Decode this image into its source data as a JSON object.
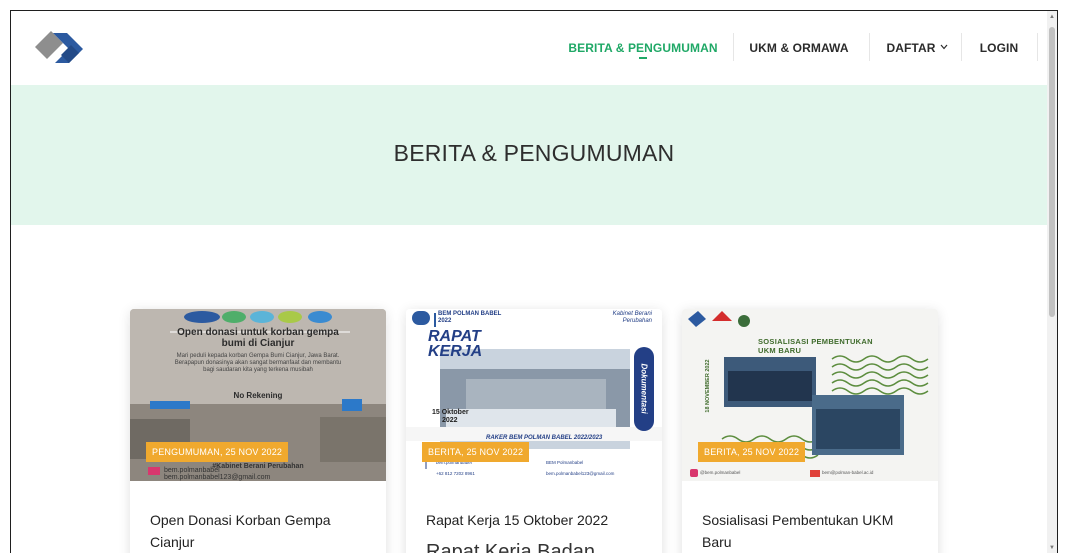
{
  "nav": {
    "items": [
      {
        "label": "BERITA & PENGUMUMAN",
        "active": true
      },
      {
        "label": "UKM & ORMAWA",
        "active": false
      },
      {
        "label": "DAFTAR",
        "active": false,
        "dropdown": true
      },
      {
        "label": "LOGIN",
        "active": false
      }
    ]
  },
  "hero": {
    "title": "BERITA & PENGUMUMAN"
  },
  "cards": [
    {
      "badge": "PENGUMUMAN, 25 NOV 2022",
      "title": "Open Donasi Korban Gempa Cianjur",
      "subtitle": "",
      "poster": {
        "headline": "Open donasi untuk korban gempa bumi di Cianjur",
        "rekening": "No Rekening",
        "footer_brand": "#Kabinet Berani Perubahan",
        "instagram": "bem.polmanbabel",
        "email": "bem.polmanbabel123@gmail.com"
      }
    },
    {
      "badge": "BERITA, 25 NOV 2022",
      "title": "Rapat Kerja 15 Oktober 2022",
      "subtitle": "Rapat Kerja Badan",
      "poster": {
        "org": "BEM POLMAN BABEL",
        "year": "2022",
        "cabinet": "Kabinet Berani Perubahan",
        "headline_1": "RAPAT",
        "headline_2": "KERJA",
        "date_1": "15 Oktober",
        "date_2": "2022",
        "side_label": "Dokumentasi",
        "bottom_title": "RAKER BEM POLMAN BABEL 2022/2023",
        "contact_web": "bem.polmanbabel",
        "contact_phone": "+62 812 7202 8961",
        "contact_yt": "BEM Polmanbabel",
        "contact_email": "bem.polmanbabel123@gmail.com"
      }
    },
    {
      "badge": "BERITA, 25 NOV 2022",
      "title": "Sosialisasi Pembentukan UKM Baru",
      "subtitle": "",
      "poster": {
        "headline_1": "SOSIALISASI PEMBENTUKAN",
        "headline_2": "UKM BARU",
        "date_vertical": "18 NOVEMBER 2022",
        "instagram": "@bem.polmanbabel",
        "email": "bem@polman-babel.ac.id"
      }
    }
  ],
  "colors": {
    "accent": "#1fa866",
    "hero_bg": "#e2f6ec",
    "badge": "#f0a92e",
    "logo_blue": "#2c5aa0",
    "logo_gray": "#8e8e8e"
  },
  "icons": {
    "logo": "logo-icon",
    "dropdown": "chevron-down-icon"
  }
}
